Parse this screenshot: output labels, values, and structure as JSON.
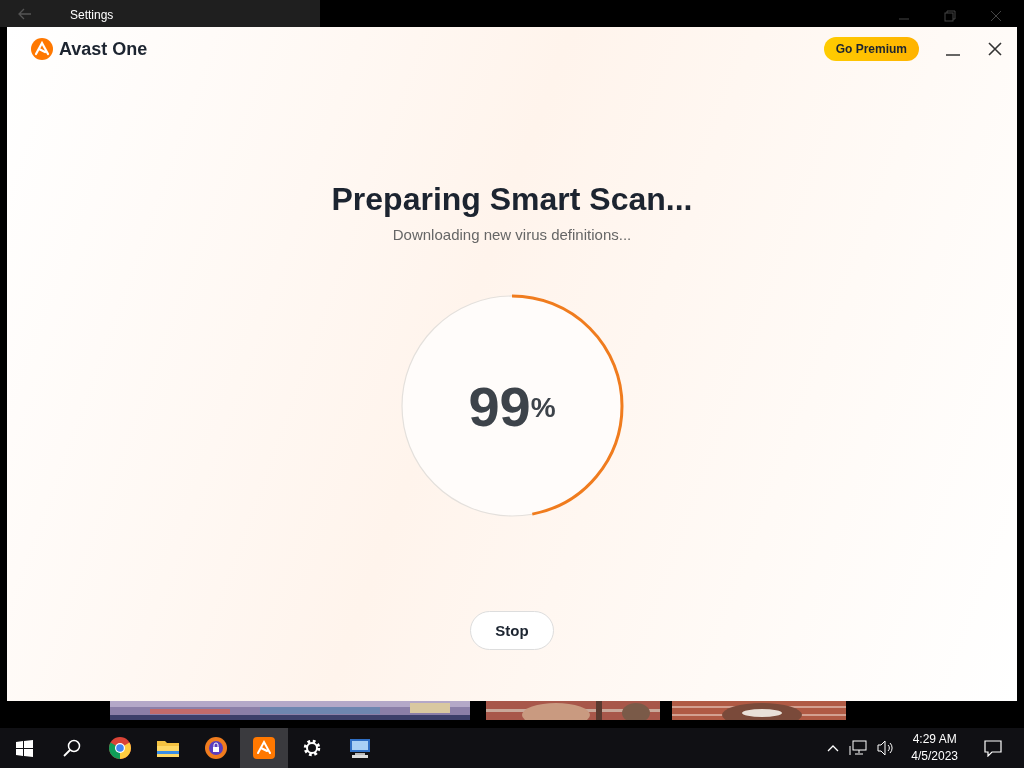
{
  "background_window": {
    "title": "Settings"
  },
  "app": {
    "name": "Avast One",
    "premium_button": "Go Premium",
    "title": "Preparing Smart Scan...",
    "subtitle": "Downloading new virus definitions...",
    "progress": {
      "value": "99",
      "unit": "%"
    },
    "stop_button": "Stop"
  },
  "taskbar": {
    "apps": [
      {
        "kind": "start",
        "active": false
      },
      {
        "kind": "search",
        "active": false
      },
      {
        "kind": "chrome",
        "active": false
      },
      {
        "kind": "folder",
        "active": false
      },
      {
        "kind": "secure-browser",
        "active": false
      },
      {
        "kind": "avast",
        "active": true
      },
      {
        "kind": "settings",
        "active": false
      },
      {
        "kind": "computer",
        "active": false
      }
    ],
    "time": "4:29 AM",
    "date": "4/5/2023"
  }
}
